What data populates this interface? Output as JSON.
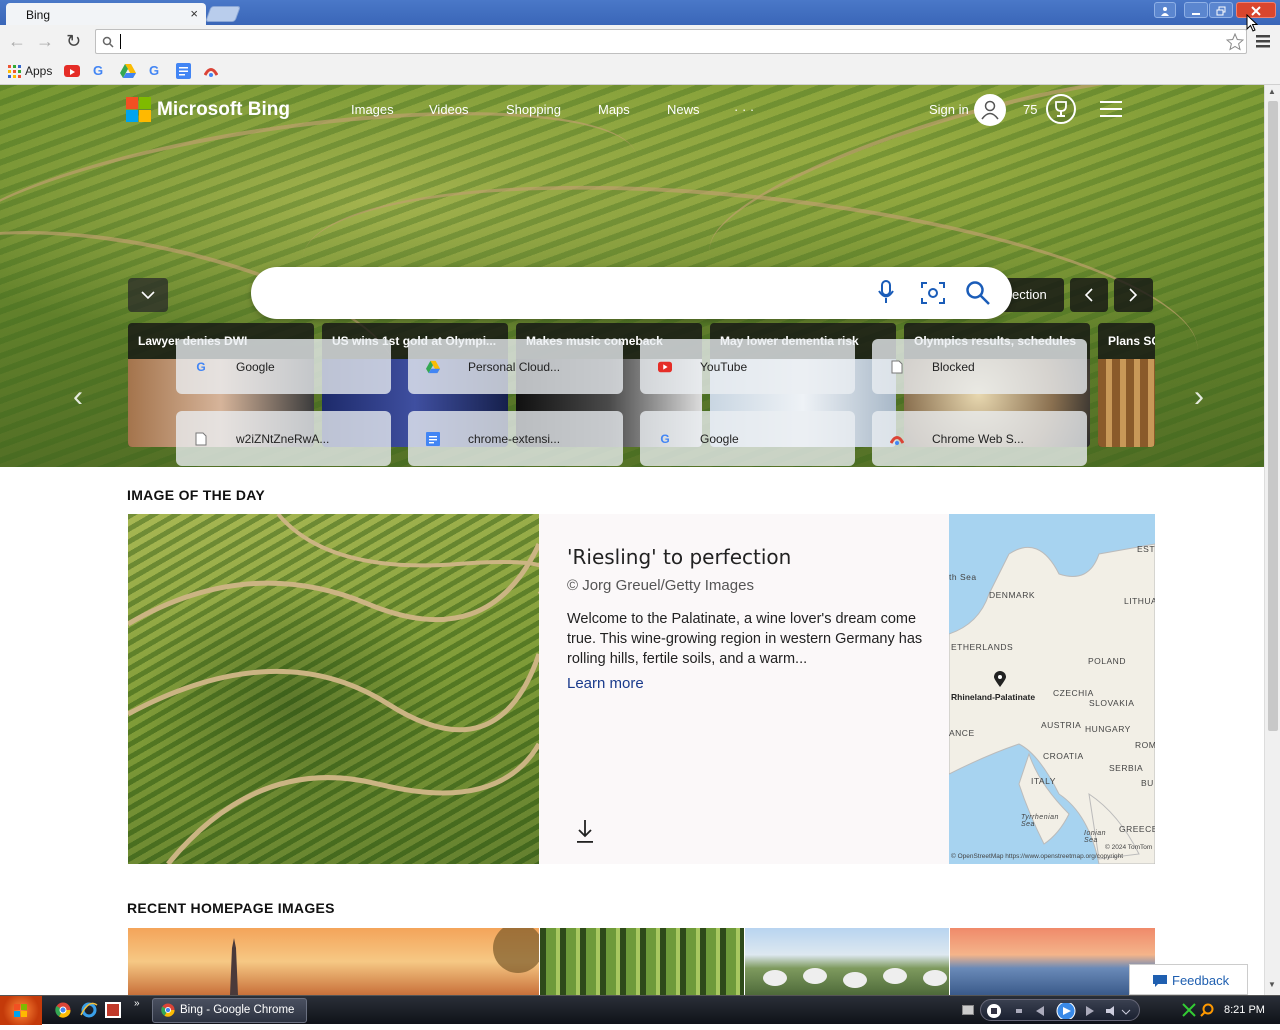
{
  "browser": {
    "tab_title": "Bing",
    "tab_close": "×",
    "address_value": "",
    "bookmarks": [
      {
        "label": "Apps",
        "icon": "apps-grid-icon"
      },
      {
        "label": "",
        "icon": "youtube-icon"
      },
      {
        "label": "",
        "icon": "google-icon"
      },
      {
        "label": "",
        "icon": "google-drive-icon"
      },
      {
        "label": "",
        "icon": "google-icon"
      },
      {
        "label": "",
        "icon": "google-docs-icon"
      },
      {
        "label": "",
        "icon": "chrome-web-store-icon"
      }
    ]
  },
  "header": {
    "logo_text": "Microsoft Bing",
    "nav": [
      "Images",
      "Videos",
      "Shopping",
      "Maps",
      "News",
      "· · ·"
    ],
    "signin": "Sign in",
    "points": "75"
  },
  "hero": {
    "collection_btn": "ection",
    "news": [
      {
        "title": "Lawyer denies DWI"
      },
      {
        "title": "US wins 1st gold at Olympi..."
      },
      {
        "title": "Makes music comeback"
      },
      {
        "title": "May lower dementia risk"
      },
      {
        "title": "Olympics results, schedules"
      },
      {
        "title": "Plans SC"
      }
    ],
    "tiles": [
      {
        "label": "Google",
        "icon": "google-icon"
      },
      {
        "label": "Personal Cloud...",
        "icon": "google-drive-icon"
      },
      {
        "label": "YouTube",
        "icon": "youtube-icon"
      },
      {
        "label": "Blocked",
        "icon": "document-icon"
      },
      {
        "label": "w2iZNtZneRwA...",
        "icon": "document-icon"
      },
      {
        "label": "chrome-extensi...",
        "icon": "google-docs-icon"
      },
      {
        "label": "Google",
        "icon": "google-icon"
      },
      {
        "label": "Chrome Web S...",
        "icon": "chrome-web-store-icon"
      }
    ]
  },
  "iotd": {
    "section_title": "IMAGE OF THE DAY",
    "title": "'Riesling' to perfection",
    "credit": "© Jorg Greuel/Getty Images",
    "description": "Welcome to the Palatinate, a wine lover's dream come true. This wine-growing region in western Germany has rolling hills, fertile soils, and a warm...",
    "learn_more": "Learn more",
    "map_labels": {
      "north_sea": "th Sea",
      "denmark": "DENMARK",
      "netherlands": "ETHERLANDS",
      "poland": "POLAND",
      "lithuania": "LITHUA",
      "rhineland": "Rhineland-Palatinate",
      "czechia": "CZECHIA",
      "slovakia": "SLOVAKIA",
      "france": "ANCE",
      "austria": "AUSTRIA",
      "hungary": "HUNGARY",
      "croatia": "CROATIA",
      "serbia": "SERBIA",
      "romania": "ROM",
      "italy": "ITALY",
      "tyrrhenian": "Tyrrhenian Sea",
      "ionian": "Ionian Sea",
      "greece": "GREECE",
      "estonia": "ESTO",
      "bu": "BU",
      "copyright1": "© 2024 TomTom",
      "copyright2": "© OpenStreetMap https://www.openstreetmap.org/copyright"
    }
  },
  "recent": {
    "section_title": "RECENT HOMEPAGE IMAGES"
  },
  "feedback": "Feedback",
  "taskbar": {
    "task_label": "Bing - Google Chrome",
    "clock": "8:21 PM"
  },
  "colors": {
    "bing_blue": "#1a3b8c",
    "ms_red": "#f25022",
    "ms_green": "#7fba00",
    "ms_blue": "#00a4ef",
    "ms_yellow": "#ffb900"
  }
}
